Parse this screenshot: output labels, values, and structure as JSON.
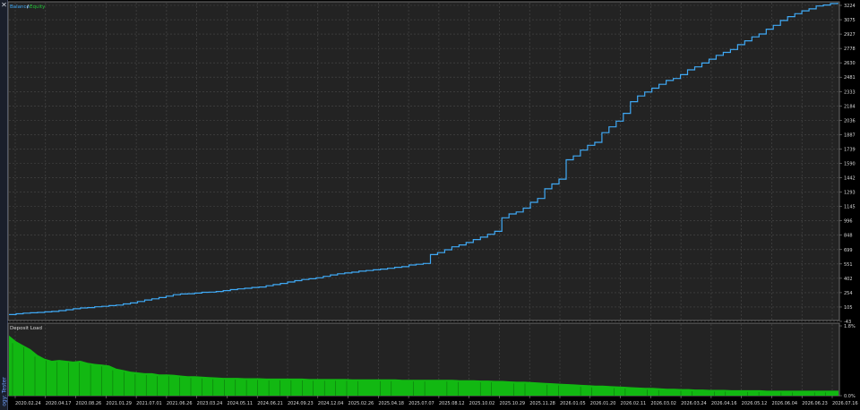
{
  "close_glyph": "✕",
  "sidebar_label": "ogy: Tester",
  "chart_data": [
    {
      "type": "line",
      "legend": [
        "Balance",
        "Equity"
      ],
      "legend_colors": [
        "#3fa9f5",
        "#22c63a"
      ],
      "line_color": "#3fa9f5",
      "grid": true,
      "yticks": [
        "3224",
        "3075",
        "2927",
        "2778",
        "2630",
        "2481",
        "2333",
        "2184",
        "2036",
        "1887",
        "1739",
        "1590",
        "1442",
        "1293",
        "1145",
        "996",
        "848",
        "699",
        "551",
        "402",
        "254",
        "105",
        "-43"
      ],
      "ylim": [
        -43,
        3224
      ],
      "xticks": [
        "2020.02.24",
        "2020.04.17",
        "2020.08.26",
        "2021.01.29",
        "2021.07.01",
        "2021.06.26",
        "2023.03.24",
        "2024.05.11",
        "2024.06.21",
        "2024.09.23",
        "2024.12.04",
        "2025.02.26",
        "2025.04.18",
        "2025.07.07",
        "2025.08.12",
        "2025.10.02",
        "2025.10.29",
        "2025.11.28",
        "2026.01.05",
        "2026.01.20",
        "2026.02.11",
        "2026.03.02",
        "2026.03.24",
        "2026.04.16",
        "2026.05.12",
        "2026.06.04",
        "2026.06.23",
        "2026.07.16"
      ],
      "series": [
        {
          "values": [
            0,
            8,
            14,
            18,
            22,
            27,
            32,
            40,
            50,
            60,
            68,
            72,
            80,
            85,
            92,
            98,
            110,
            120,
            135,
            150,
            162,
            175,
            190,
            205,
            212,
            215,
            222,
            230,
            232,
            238,
            248,
            258,
            265,
            272,
            280,
            285,
            298,
            310,
            322,
            336,
            350,
            362,
            370,
            380,
            395,
            410,
            422,
            430,
            438,
            448,
            455,
            462,
            470,
            478,
            488,
            495,
            512,
            520,
            528,
            620,
            640,
            670,
            700,
            720,
            745,
            775,
            800,
            830,
            860,
            1000,
            1040,
            1060,
            1100,
            1160,
            1200,
            1300,
            1350,
            1400,
            1600,
            1640,
            1700,
            1750,
            1780,
            1880,
            1940,
            2000,
            2080,
            2200,
            2260,
            2300,
            2340,
            2380,
            2420,
            2440,
            2480,
            2530,
            2560,
            2600,
            2640,
            2680,
            2710,
            2740,
            2790,
            2830,
            2870,
            2900,
            2950,
            2990,
            3040,
            3080,
            3110,
            3140,
            3160,
            3190,
            3200,
            3215,
            3224
          ]
        }
      ]
    },
    {
      "type": "area",
      "title": "Deposit Load",
      "color": "#12b812",
      "yticks": [
        "1.8%",
        "0.0%"
      ],
      "ylim": [
        0,
        1.8
      ],
      "values": [
        1.55,
        1.4,
        1.3,
        1.2,
        1.05,
        0.95,
        0.9,
        0.92,
        0.9,
        0.88,
        0.9,
        0.85,
        0.82,
        0.8,
        0.78,
        0.7,
        0.66,
        0.62,
        0.6,
        0.58,
        0.58,
        0.55,
        0.55,
        0.54,
        0.52,
        0.5,
        0.5,
        0.49,
        0.48,
        0.47,
        0.46,
        0.46,
        0.46,
        0.45,
        0.45,
        0.45,
        0.44,
        0.44,
        0.44,
        0.44,
        0.44,
        0.44,
        0.43,
        0.43,
        0.43,
        0.43,
        0.43,
        0.43,
        0.42,
        0.42,
        0.42,
        0.42,
        0.42,
        0.42,
        0.42,
        0.41,
        0.41,
        0.41,
        0.41,
        0.41,
        0.41,
        0.41,
        0.41,
        0.4,
        0.4,
        0.4,
        0.39,
        0.39,
        0.38,
        0.38,
        0.37,
        0.36,
        0.36,
        0.35,
        0.34,
        0.33,
        0.32,
        0.31,
        0.3,
        0.29,
        0.28,
        0.27,
        0.26,
        0.26,
        0.25,
        0.24,
        0.23,
        0.22,
        0.21,
        0.2,
        0.2,
        0.19,
        0.18,
        0.18,
        0.17,
        0.17,
        0.16,
        0.16,
        0.15,
        0.15,
        0.15,
        0.14,
        0.14,
        0.14,
        0.14,
        0.14,
        0.13,
        0.13,
        0.13,
        0.13,
        0.13,
        0.13,
        0.13,
        0.13,
        0.13,
        0.13,
        0.13
      ]
    }
  ]
}
